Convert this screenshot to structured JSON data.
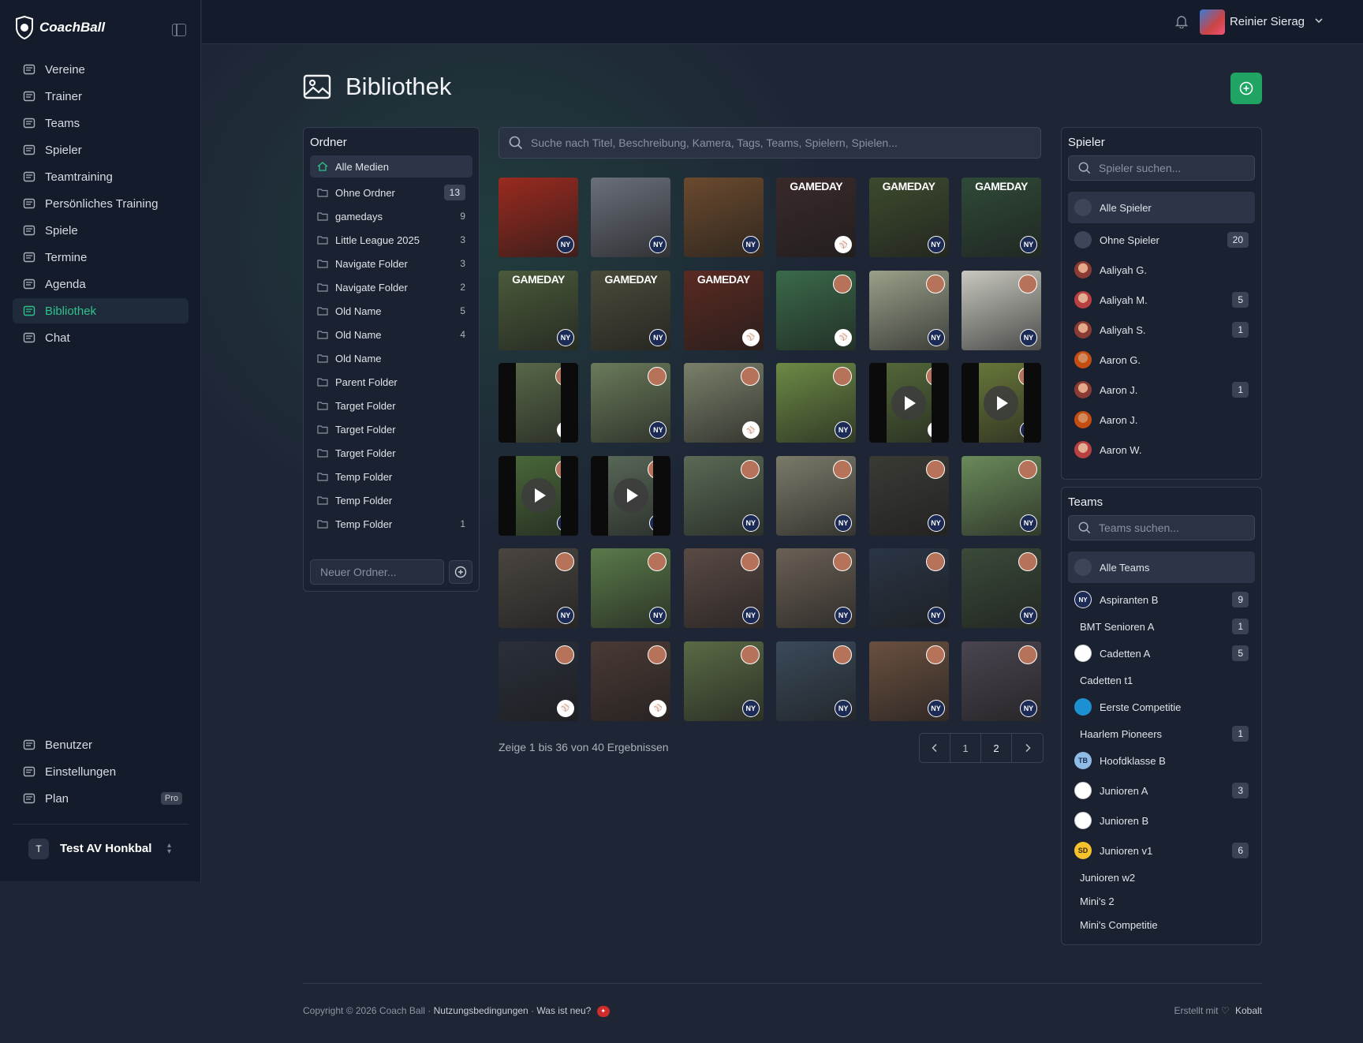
{
  "app": {
    "name": "CoachBall"
  },
  "nav": {
    "items": [
      {
        "label": "Vereine"
      },
      {
        "label": "Trainer"
      },
      {
        "label": "Teams"
      },
      {
        "label": "Spieler"
      },
      {
        "label": "Teamtraining"
      },
      {
        "label": "Persönliches Training"
      },
      {
        "label": "Spiele"
      },
      {
        "label": "Termine"
      },
      {
        "label": "Agenda"
      },
      {
        "label": "Bibliothek",
        "active": true
      },
      {
        "label": "Chat"
      }
    ],
    "bottom": [
      {
        "label": "Benutzer"
      },
      {
        "label": "Einstellungen"
      },
      {
        "label": "Plan",
        "badge": "Pro"
      }
    ]
  },
  "org": {
    "initial": "T",
    "name": "Test AV Honkbal"
  },
  "user": {
    "name": "Reinier Sierag"
  },
  "page": {
    "title": "Bibliothek"
  },
  "folders": {
    "title": "Ordner",
    "items": [
      {
        "label": "Alle Medien",
        "count": "",
        "active": true
      },
      {
        "label": "Ohne Ordner",
        "count": "13",
        "boxed": true
      },
      {
        "label": "gamedays",
        "count": "9"
      },
      {
        "label": "Little League 2025",
        "count": "3"
      },
      {
        "label": "Navigate Folder",
        "count": "3"
      },
      {
        "label": "Navigate Folder",
        "count": "2"
      },
      {
        "label": "Old Name",
        "count": "5"
      },
      {
        "label": "Old Name",
        "count": "4"
      },
      {
        "label": "Old Name",
        "count": ""
      },
      {
        "label": "Parent Folder",
        "count": ""
      },
      {
        "label": "Target Folder",
        "count": ""
      },
      {
        "label": "Target Folder",
        "count": ""
      },
      {
        "label": "Target Folder",
        "count": ""
      },
      {
        "label": "Temp Folder",
        "count": ""
      },
      {
        "label": "Temp Folder",
        "count": ""
      },
      {
        "label": "Temp Folder",
        "count": "1"
      }
    ],
    "new_placeholder": "Neuer Ordner..."
  },
  "search": {
    "placeholder": "Suche nach Titel, Beschreibung, Kamera, Tags, Teams, Spielern, Spielen..."
  },
  "media": [
    {
      "kind": "poster",
      "text": "",
      "bg": "#9a2a1f"
    },
    {
      "kind": "poster",
      "text": "",
      "bg": "#6a6f7a"
    },
    {
      "kind": "poster",
      "text": "",
      "bg": "#6b4a2e"
    },
    {
      "kind": "poster",
      "text": "GAMEDAY",
      "bg": "#3a2a2a"
    },
    {
      "kind": "poster",
      "text": "GAMEDAY",
      "bg": "#3d4a2e"
    },
    {
      "kind": "poster",
      "text": "GAMEDAY",
      "bg": "#2f4a38"
    },
    {
      "kind": "poster",
      "text": "GAMEDAY",
      "bg": "#4a5a3a"
    },
    {
      "kind": "poster",
      "text": "GAMEDAY",
      "bg": "#4a4a3a"
    },
    {
      "kind": "poster",
      "text": "GAMEDAY",
      "bg": "#5a2a22"
    },
    {
      "kind": "photo",
      "text": "",
      "bg": "#3a6a4a"
    },
    {
      "kind": "photo",
      "text": "",
      "bg": "#9aa08a"
    },
    {
      "kind": "photo",
      "text": "",
      "bg": "#c8c8c0"
    },
    {
      "kind": "video",
      "text": "",
      "bg": "#5a6a4a"
    },
    {
      "kind": "photo",
      "text": "",
      "bg": "#6a7a5a"
    },
    {
      "kind": "photo",
      "text": "",
      "bg": "#7a806a"
    },
    {
      "kind": "photo",
      "text": "",
      "bg": "#6c8a45"
    },
    {
      "kind": "video",
      "text": "",
      "bg": "#556a3a"
    },
    {
      "kind": "video",
      "text": "",
      "bg": "#6a7a3a"
    },
    {
      "kind": "video",
      "text": "",
      "bg": "#4a6a3a"
    },
    {
      "kind": "video",
      "text": "",
      "bg": "#5a6a5a"
    },
    {
      "kind": "photo",
      "text": "",
      "bg": "#5a6a55"
    },
    {
      "kind": "photo",
      "text": "",
      "bg": "#7a7a6a"
    },
    {
      "kind": "photo",
      "text": "",
      "bg": "#3a3a35"
    },
    {
      "kind": "photo",
      "text": "",
      "bg": "#6a8a5a"
    },
    {
      "kind": "photo",
      "text": "",
      "bg": "#4a4540"
    },
    {
      "kind": "photo",
      "text": "",
      "bg": "#5a7a4a"
    },
    {
      "kind": "photo",
      "text": "",
      "bg": "#5a4a45"
    },
    {
      "kind": "photo",
      "text": "",
      "bg": "#6a6055"
    },
    {
      "kind": "photo",
      "text": "",
      "bg": "#2a3545"
    },
    {
      "kind": "photo",
      "text": "",
      "bg": "#3a4a3a"
    },
    {
      "kind": "photo",
      "text": "",
      "bg": "#2a2f3a"
    },
    {
      "kind": "photo",
      "text": "",
      "bg": "#4a3a35"
    },
    {
      "kind": "photo",
      "text": "",
      "bg": "#5a6a45"
    },
    {
      "kind": "photo",
      "text": "",
      "bg": "#3a4a5a"
    },
    {
      "kind": "photo",
      "text": "",
      "bg": "#6a5040"
    },
    {
      "kind": "photo",
      "text": "",
      "bg": "#4a4550"
    }
  ],
  "results_text": "Zeige 1 bis 36 von 40 Ergebnissen",
  "pagination": {
    "pages": [
      "1",
      "2"
    ]
  },
  "players": {
    "title": "Spieler",
    "search_placeholder": "Spieler suchen...",
    "items": [
      {
        "label": "Alle Spieler",
        "count": "",
        "active": true,
        "avatar": "grey"
      },
      {
        "label": "Ohne Spieler",
        "count": "20",
        "avatar": "grey"
      },
      {
        "label": "Aaliyah G.",
        "count": "",
        "avatar": "face1"
      },
      {
        "label": "Aaliyah M.",
        "count": "5",
        "avatar": "face3"
      },
      {
        "label": "Aaliyah S.",
        "count": "1",
        "avatar": "face1"
      },
      {
        "label": "Aaron G.",
        "count": "",
        "avatar": "face4"
      },
      {
        "label": "Aaron J.",
        "count": "1",
        "avatar": "face1"
      },
      {
        "label": "Aaron J.",
        "count": "",
        "avatar": "face4"
      },
      {
        "label": "Aaron W.",
        "count": "",
        "avatar": "face3"
      }
    ]
  },
  "teams": {
    "title": "Teams",
    "search_placeholder": "Teams suchen...",
    "items": [
      {
        "label": "Alle Teams",
        "count": "",
        "active": true,
        "avatar": "grey"
      },
      {
        "label": "Aspiranten B",
        "count": "9",
        "avatar": "ny"
      },
      {
        "label": "BMT Senioren A",
        "count": "1",
        "avatar": ""
      },
      {
        "label": "Cadetten A",
        "count": "5",
        "avatar": "ball"
      },
      {
        "label": "Cadetten t1",
        "count": "",
        "avatar": ""
      },
      {
        "label": "Eerste Competitie",
        "count": "",
        "avatar": "marlin"
      },
      {
        "label": "Haarlem Pioneers",
        "count": "1",
        "avatar": ""
      },
      {
        "label": "Hoofdklasse B",
        "count": "",
        "avatar": "tb"
      },
      {
        "label": "Junioren A",
        "count": "3",
        "avatar": "ball"
      },
      {
        "label": "Junioren B",
        "count": "",
        "avatar": "ball"
      },
      {
        "label": "Junioren v1",
        "count": "6",
        "avatar": "sd"
      },
      {
        "label": "Junioren w2",
        "count": "",
        "avatar": ""
      },
      {
        "label": "Mini's 2",
        "count": "",
        "avatar": ""
      },
      {
        "label": "Mini's Competitie",
        "count": "",
        "avatar": ""
      }
    ]
  },
  "footer": {
    "copyright": "Copyright © 2026 Coach Ball ·",
    "terms": "Nutzungsbedingungen",
    "sep": "·",
    "whats_new": "Was ist neu?",
    "made_with": "Erstellt mit",
    "brand": "Kobalt"
  }
}
